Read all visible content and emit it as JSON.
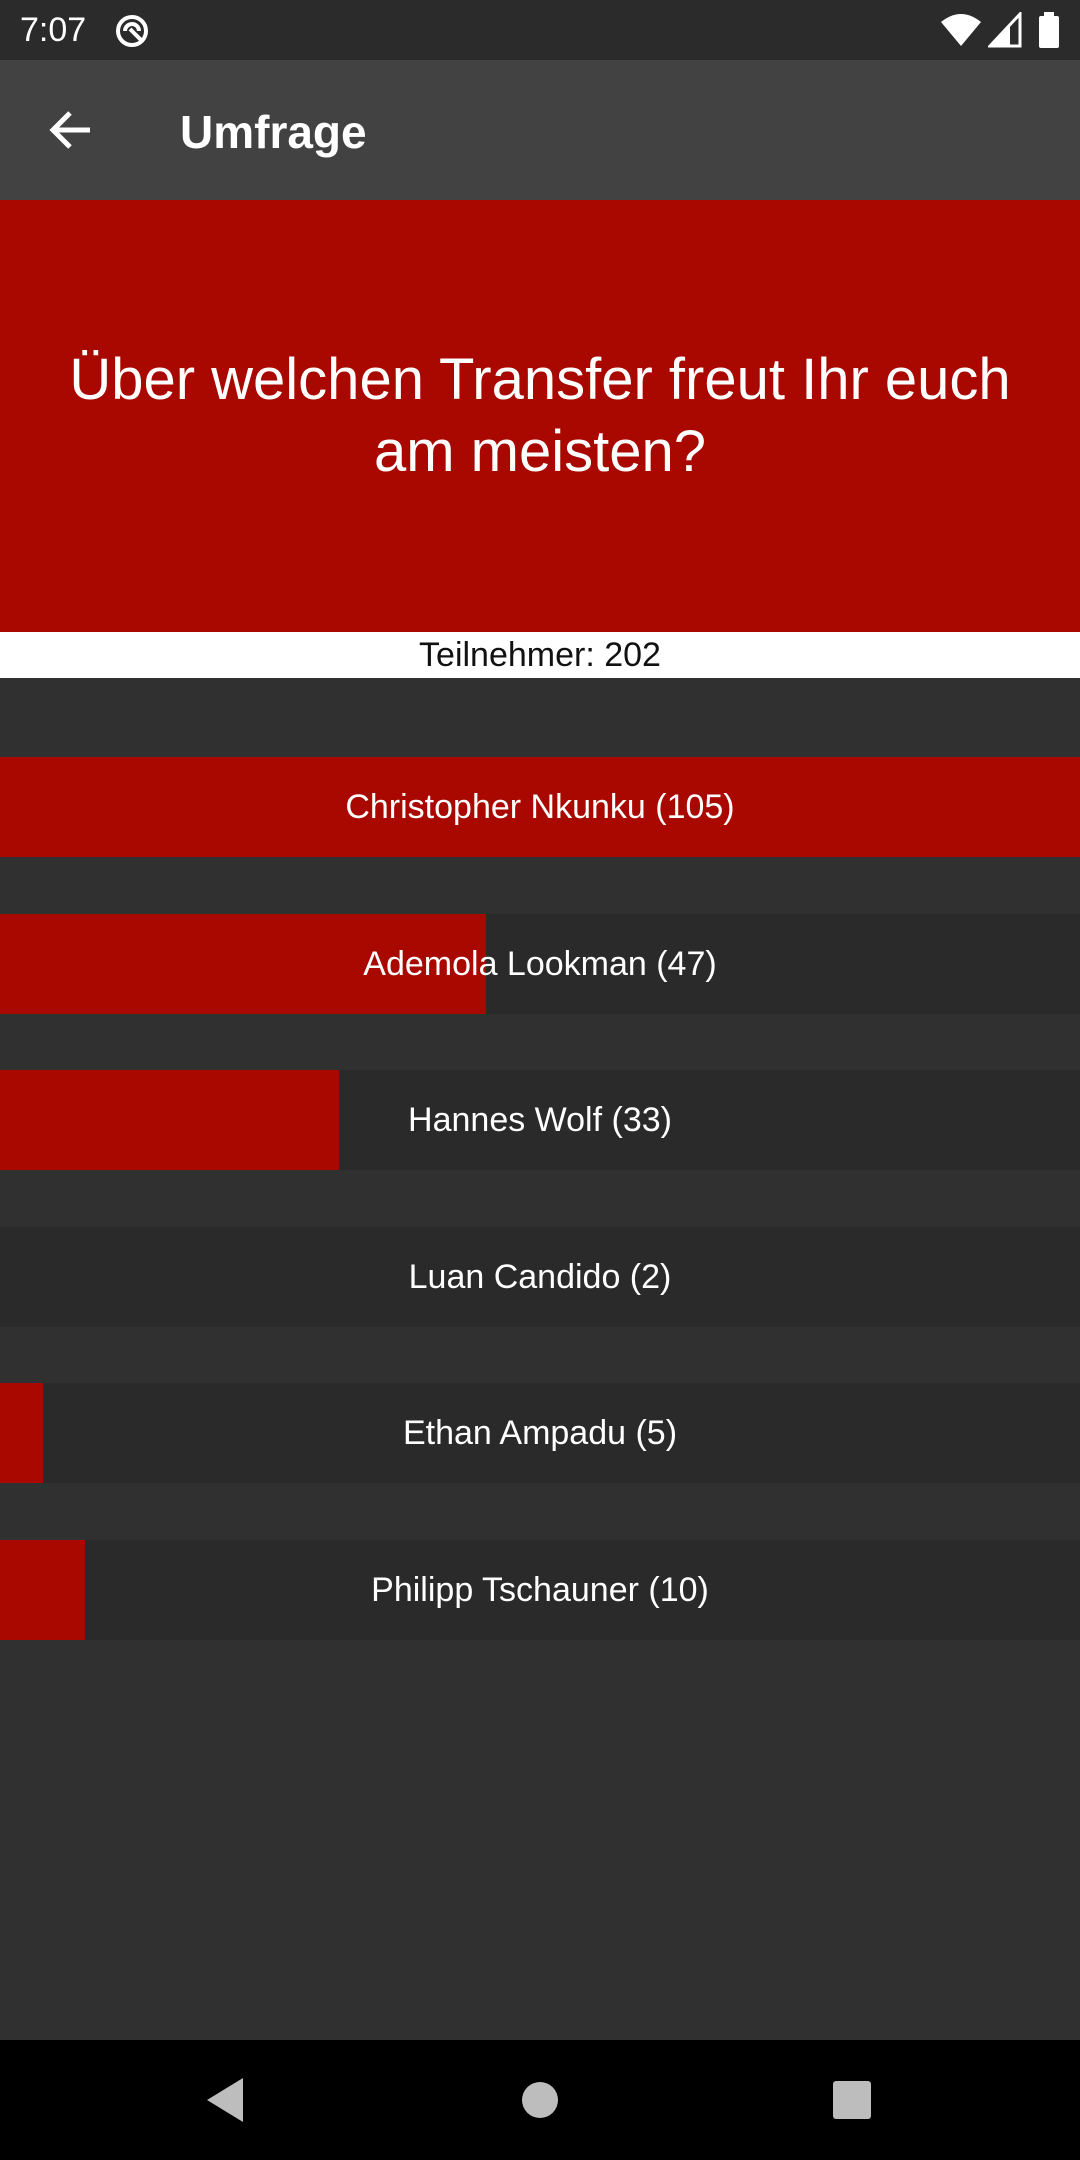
{
  "status_bar": {
    "time": "7:07",
    "icons": [
      "app-notification-icon",
      "wifi-icon",
      "cell-signal-icon",
      "battery-icon"
    ]
  },
  "app_bar": {
    "title": "Umfrage",
    "back_icon": "arrow-back-icon"
  },
  "poll": {
    "question": "Über welchen Transfer freut Ihr euch am meisten?",
    "participants_text": "Teilnehmer: 202",
    "total": 202,
    "options": [
      {
        "label": "Christopher Nkunku (105)",
        "votes": 105,
        "fill_fraction": 1.0
      },
      {
        "label": "Ademola Lookman (47)",
        "votes": 47,
        "fill_fraction": 0.45
      },
      {
        "label": "Hannes Wolf (33)",
        "votes": 33,
        "fill_fraction": 0.314
      },
      {
        "label": "Luan Candido (2)",
        "votes": 2,
        "fill_fraction": 0.0
      },
      {
        "label": "Ethan Ampadu (5)",
        "votes": 5,
        "fill_fraction": 0.04
      },
      {
        "label": "Philipp Tschauner (10)",
        "votes": 10,
        "fill_fraction": 0.079
      }
    ]
  },
  "colors": {
    "accent": "#a90800",
    "background": "#303030",
    "bar_track": "#2a2a2a",
    "app_bar": "#424242"
  },
  "nav_bar": {
    "buttons": [
      "back-triangle-icon",
      "home-circle-icon",
      "recents-square-icon"
    ]
  }
}
